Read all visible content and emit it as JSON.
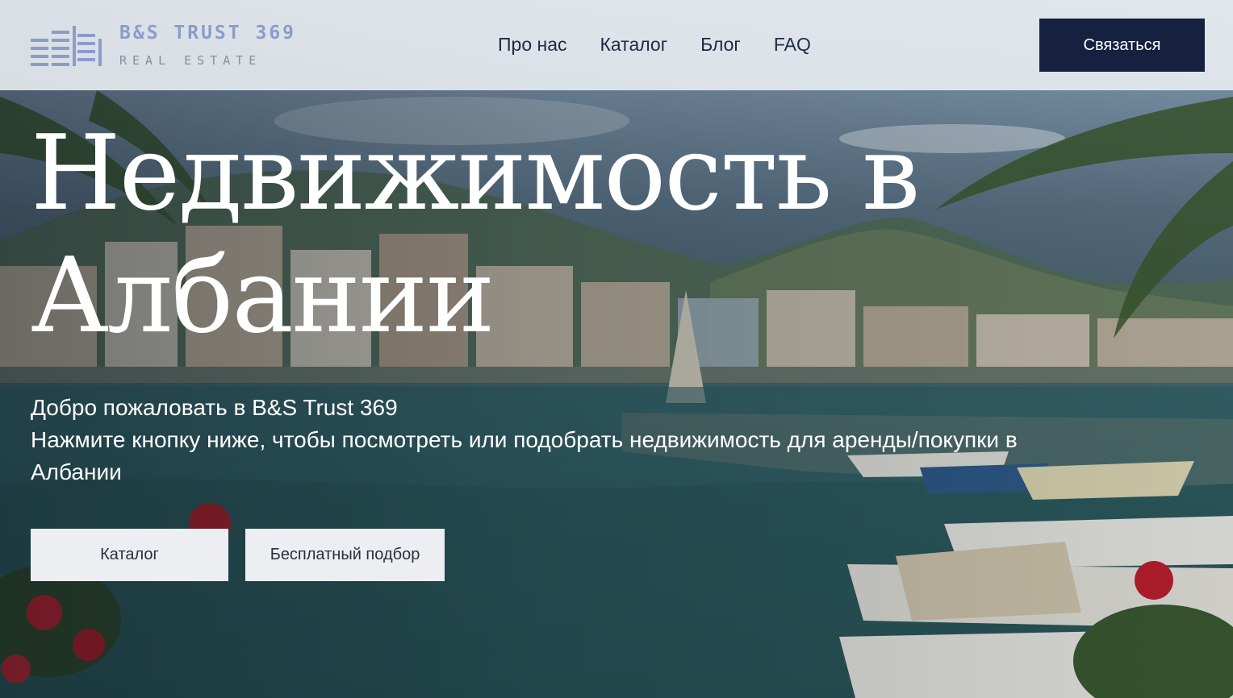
{
  "brand": {
    "name": "B&S TRUST 369",
    "tagline": "REAL ESTATE",
    "logo_icon": "building-stack-icon",
    "colors": {
      "name": "#8a9ccb",
      "tagline": "#8a8f9a"
    }
  },
  "nav": {
    "items": [
      {
        "label": "Про нас"
      },
      {
        "label": "Каталог"
      },
      {
        "label": "Блог"
      },
      {
        "label": "FAQ"
      }
    ]
  },
  "header": {
    "contact_label": "Связаться",
    "colors": {
      "button_bg": "#16203f",
      "nav_text": "#1f2a44"
    }
  },
  "hero": {
    "title": "Недвижимость в Албании",
    "subtitle_line1": "Добро пожаловать в B&S Trust 369",
    "subtitle_line2": "Нажмите кнопку ниже, чтобы посмотреть или подобрать недвижимость для аренды/покупки в Албании",
    "buttons": {
      "catalog": "Каталог",
      "free_selection": "Бесплатный подбор"
    },
    "background": "coastal-town-harbor-image"
  }
}
